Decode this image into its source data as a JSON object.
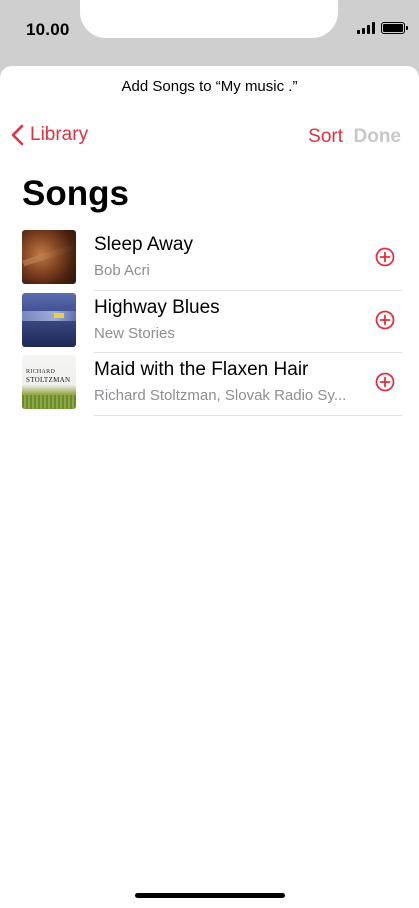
{
  "status_bar": {
    "time": "10.00"
  },
  "sheet": {
    "prompt": "Add Songs to “My music .”"
  },
  "nav": {
    "back_label": "Library",
    "sort_label": "Sort",
    "done_label": "Done"
  },
  "page": {
    "title": "Songs"
  },
  "songs": [
    {
      "title": "Sleep Away",
      "artist": "Bob Acri"
    },
    {
      "title": "Highway Blues",
      "artist": "New Stories"
    },
    {
      "title": "Maid with the Flaxen Hair",
      "artist": "Richard Stoltzman, Slovak Radio Sy..."
    }
  ],
  "album_art": {
    "art3_line1": "RICHARD",
    "art3_line2": "STOLTZMAN"
  },
  "colors": {
    "accent": "#e0313f",
    "disabled": "#c8c8c8",
    "secondary_text": "#8e8e93"
  },
  "icons": {
    "back": "chevron-left-icon",
    "add": "plus-circle-icon",
    "signal": "cellular-signal-icon",
    "battery": "battery-icon"
  }
}
